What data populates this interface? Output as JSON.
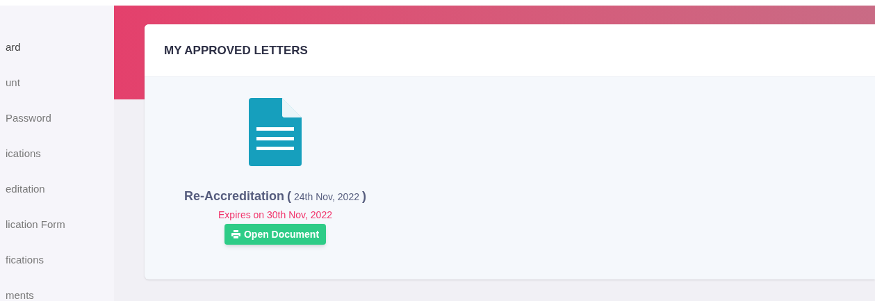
{
  "sidebar": {
    "items": [
      {
        "label": "ard",
        "selected": true
      },
      {
        "label": "unt",
        "selected": false
      },
      {
        "label": "Password",
        "selected": false
      },
      {
        "label": "ications",
        "selected": false
      },
      {
        "label": "editation",
        "selected": false
      },
      {
        "label": "lication Form",
        "selected": false
      },
      {
        "label": "fications",
        "selected": false
      },
      {
        "label": "ments",
        "selected": false
      }
    ]
  },
  "card": {
    "title": "MY APPROVED LETTERS",
    "letters": [
      {
        "name": "Re-Accreditation",
        "open_paren": "(",
        "date": "24th Nov, 2022",
        "close_paren": ")",
        "expiry": "Expires on 30th Nov, 2022",
        "button": "Open Document"
      }
    ]
  }
}
